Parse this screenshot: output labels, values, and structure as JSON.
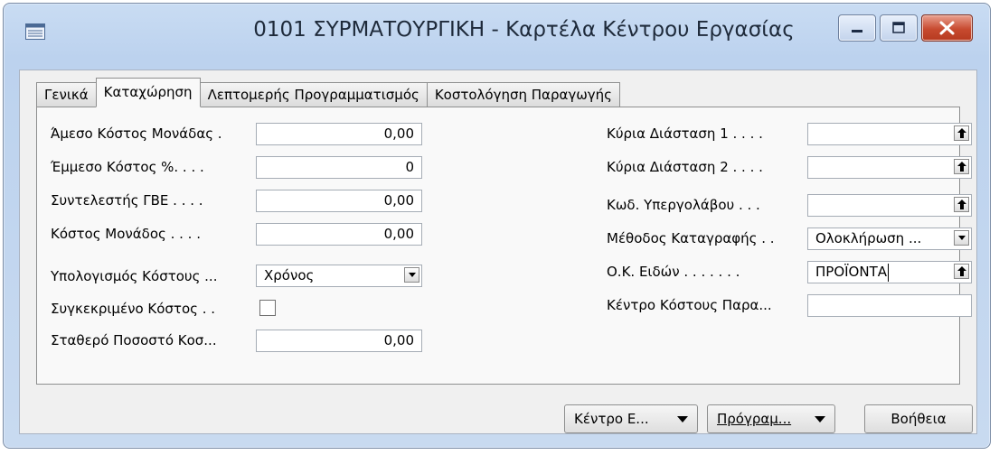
{
  "window": {
    "title": "0101 ΣΥΡΜΑΤΟΥΡΓΙΚΗ - Καρτέλα Κέντρου Εργασίας"
  },
  "tabs": [
    {
      "label": "Γενικά",
      "active": false
    },
    {
      "label": "Καταχώρηση",
      "active": true
    },
    {
      "label": "Λεπτομερής Προγραμματισμός",
      "active": false
    },
    {
      "label": "Κοστολόγηση Παραγωγής",
      "active": false
    }
  ],
  "left": {
    "direct_cost": {
      "label": "Άμεσο Κόστος Μονάδας .",
      "value": "0,00"
    },
    "indirect_cost": {
      "label": "Έμμεσο Κόστος %. . . .",
      "value": "0"
    },
    "overhead_rate": {
      "label": "Συντελεστής ΓΒΕ . . . .",
      "value": "0,00"
    },
    "unit_cost": {
      "label": "Κόστος Μονάδος . . . .",
      "value": "0,00"
    },
    "cost_calc": {
      "label": "Υπολογισμός Κόστους ...",
      "value": "Χρόνος"
    },
    "specific_cost": {
      "label": "Συγκεκριμένο Κόστος . .",
      "checked": false
    },
    "fixed_pct": {
      "label": "Σταθερό Ποσοστό Κοσ...",
      "value": "0,00"
    }
  },
  "right": {
    "dim1": {
      "label": "Κύρια Διάσταση 1 . . . .",
      "value": ""
    },
    "dim2": {
      "label": "Κύρια Διάσταση 2 . . . .",
      "value": ""
    },
    "subcontractor": {
      "label": "Κωδ. Υπεργολάβου . . .",
      "value": ""
    },
    "flushing": {
      "label": "Μέθοδος Καταγραφής . .",
      "value": "Ολοκλήρωση ..."
    },
    "item_group": {
      "label": "Ο.Κ. Ειδών . . . . . . .",
      "value": "ΠΡΟΪΟΝΤΑ"
    },
    "cost_center": {
      "label": "Κέντρο Κόστους Παρα...",
      "value": ""
    }
  },
  "buttons": {
    "work_center": "Κέντρο Ε...",
    "schedule": "Πρόγραμ...",
    "help": "Βοήθεια"
  }
}
